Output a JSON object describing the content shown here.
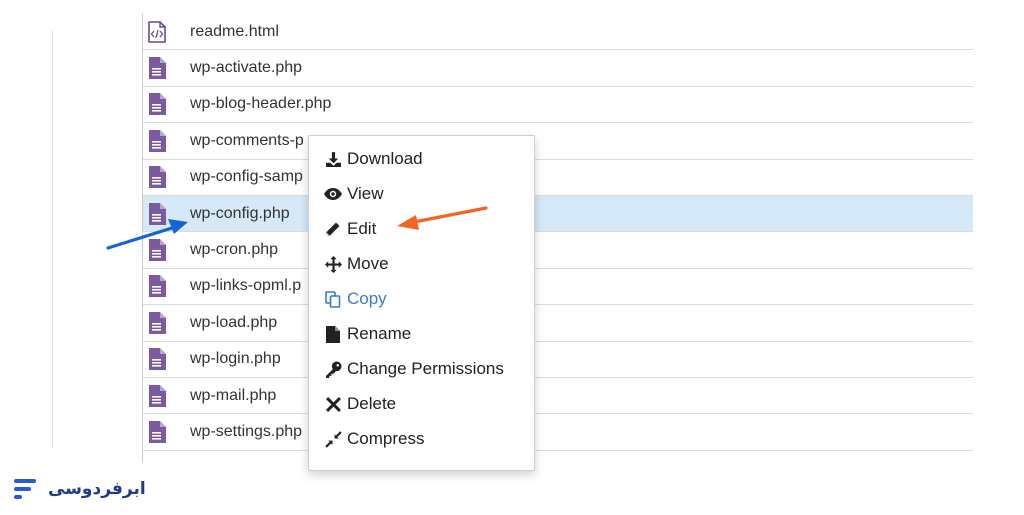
{
  "files": [
    {
      "name": "readme.html",
      "icon": "html-file-icon",
      "selected": false
    },
    {
      "name": "wp-activate.php",
      "icon": "php-file-icon",
      "selected": false
    },
    {
      "name": "wp-blog-header.php",
      "icon": "php-file-icon",
      "selected": false
    },
    {
      "name": "wp-comments-p",
      "icon": "php-file-icon",
      "selected": false
    },
    {
      "name": "wp-config-samp",
      "icon": "php-file-icon",
      "selected": false
    },
    {
      "name": "wp-config.php",
      "icon": "php-file-icon",
      "selected": true
    },
    {
      "name": "wp-cron.php",
      "icon": "php-file-icon",
      "selected": false
    },
    {
      "name": "wp-links-opml.p",
      "icon": "php-file-icon",
      "selected": false
    },
    {
      "name": "wp-load.php",
      "icon": "php-file-icon",
      "selected": false
    },
    {
      "name": "wp-login.php",
      "icon": "php-file-icon",
      "selected": false
    },
    {
      "name": "wp-mail.php",
      "icon": "php-file-icon",
      "selected": false
    },
    {
      "name": "wp-settings.php",
      "icon": "php-file-icon",
      "selected": false
    }
  ],
  "context_menu": {
    "items": [
      {
        "label": "Download",
        "icon": "download-icon"
      },
      {
        "label": "View",
        "icon": "eye-icon"
      },
      {
        "label": "Edit",
        "icon": "pencil-icon"
      },
      {
        "label": "Move",
        "icon": "move-arrows-icon"
      },
      {
        "label": "Copy",
        "icon": "copy-icon",
        "disabled": true
      },
      {
        "label": "Rename",
        "icon": "file-icon"
      },
      {
        "label": "Change Permissions",
        "icon": "key-icon"
      },
      {
        "label": "Delete",
        "icon": "x-icon"
      },
      {
        "label": "Compress",
        "icon": "compress-icon"
      }
    ]
  },
  "annotations": {
    "blue_arrow_color": "#1565d8",
    "orange_arrow_color": "#f26522"
  },
  "brand": {
    "name": "ابرفردوسی",
    "color": "#1e3a8a",
    "mark_color": "#2a5bd7"
  },
  "colors": {
    "file_icon": "#7b5a9e",
    "selected_row": "#d5e9f8",
    "row_border": "#dcdcdc"
  }
}
